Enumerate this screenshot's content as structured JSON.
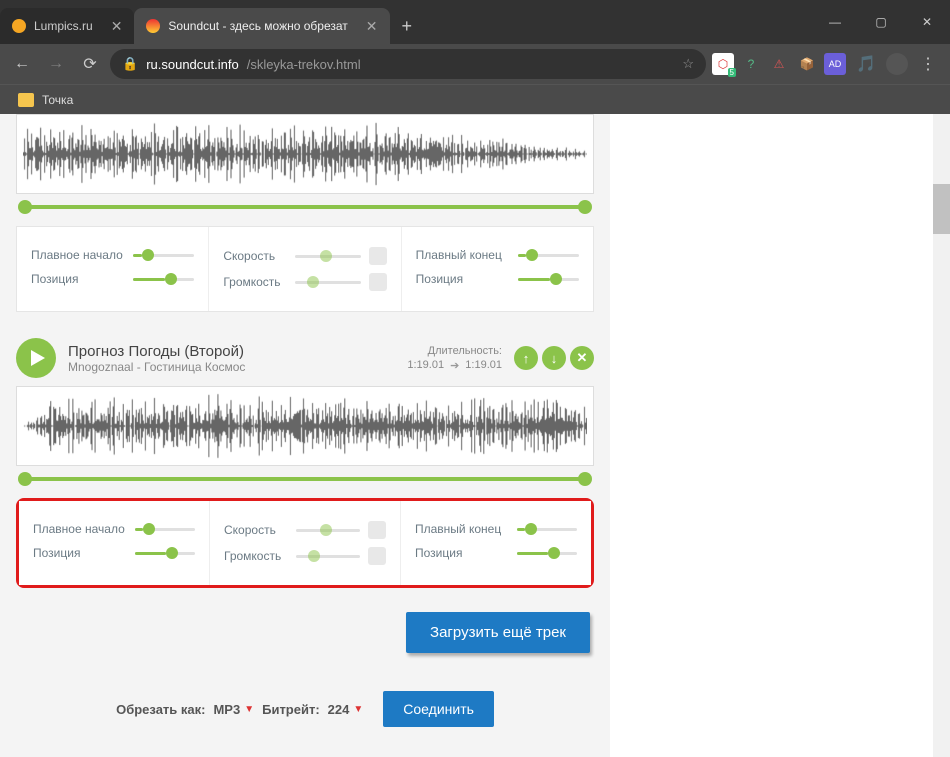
{
  "window": {
    "minimize": "—",
    "maximize": "▢",
    "close": "✕"
  },
  "tabs": {
    "inactive": {
      "title": "Lumpics.ru",
      "close": "✕"
    },
    "active": {
      "title": "Soundcut - здесь можно обрезат",
      "close": "✕"
    },
    "new": "+"
  },
  "address": {
    "host": "ru.soundcut.info",
    "path": "/skleyka-trekov.html"
  },
  "bookmarks": {
    "folder": "Точка"
  },
  "ext_badge": "5",
  "controls": {
    "fade_in": "Плавное начало",
    "position": "Позиция",
    "speed": "Скорость",
    "volume": "Громкость",
    "fade_out": "Плавный конец"
  },
  "track2": {
    "title": "Прогноз Погоды (Второй)",
    "artist": "Mnogoznaal - Гостиница Космос",
    "dur_label": "Длительность:",
    "dur_from": "1:19.01",
    "dur_to": "1:19.01"
  },
  "buttons": {
    "load_more": "Загрузить ещё трек",
    "join": "Соединить"
  },
  "footer": {
    "cut_as": "Обрезать как:",
    "format": "MP3",
    "bitrate_label": "Битрейт:",
    "bitrate": "224"
  }
}
